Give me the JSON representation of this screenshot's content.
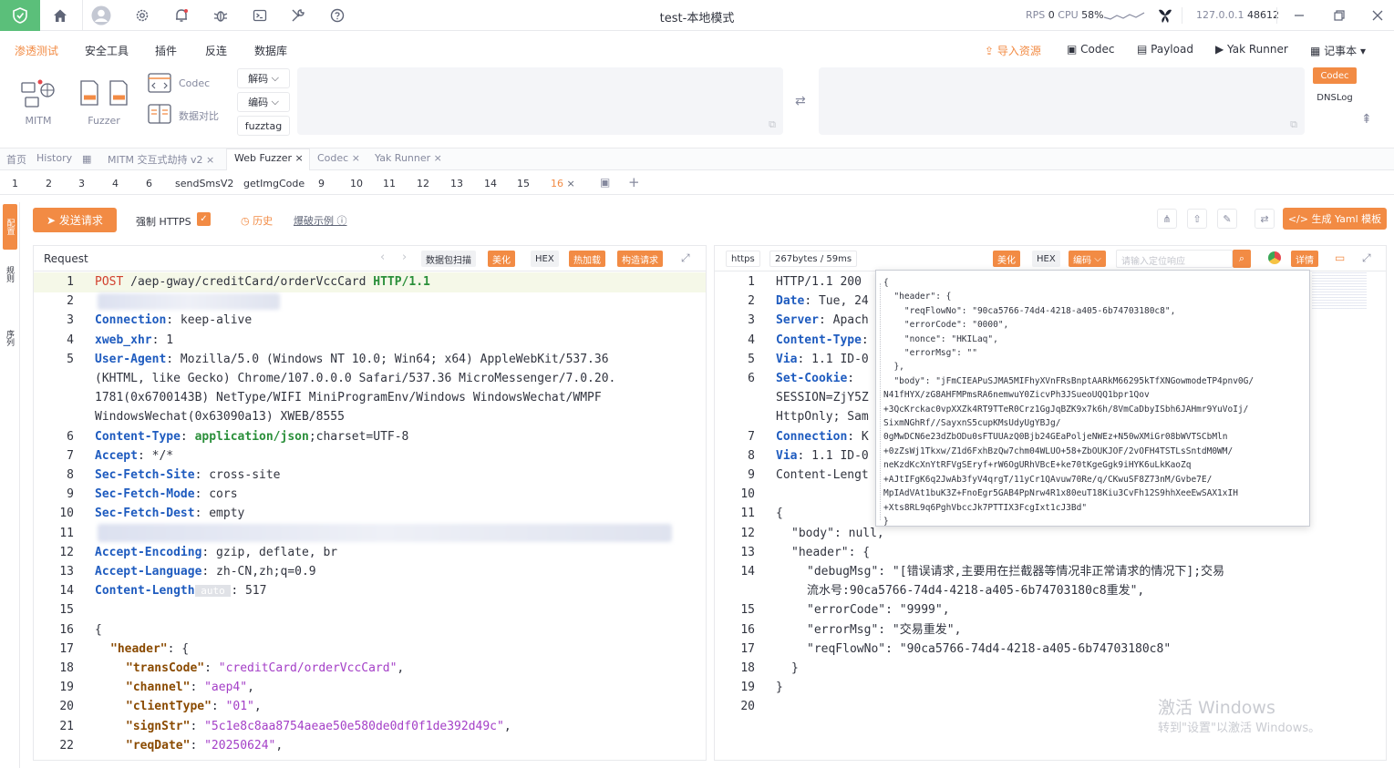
{
  "titlebar": {
    "title": "test-本地模式",
    "rps_label": "RPS",
    "rps_value": "0",
    "cpu_label": "CPU",
    "cpu_value": "58%",
    "host": "127.0.0.1",
    "port": "48612"
  },
  "menu": [
    "渗透测试",
    "安全工具",
    "插件",
    "反连",
    "数据库"
  ],
  "menu_right": [
    "导入资源",
    "Codec",
    "Payload",
    "Yak Runner",
    "记事本"
  ],
  "toolbar": {
    "mitm": "MITM",
    "fuzzer": "Fuzzer",
    "codec": "Codec",
    "data_compare": "数据对比",
    "decode": "解码",
    "encode": "编码",
    "fuzztag": "fuzztag",
    "side_codec": "Codec",
    "side_dnslog": "DNSLog"
  },
  "tabs1": [
    {
      "label": "首页"
    },
    {
      "label": "History"
    },
    {
      "label": "MITM 交互式劫持 v2"
    },
    {
      "label": "Web Fuzzer"
    },
    {
      "label": "Codec"
    },
    {
      "label": "Yak Runner"
    }
  ],
  "tabs2": [
    "1",
    "2",
    "3",
    "4",
    "6",
    "sendSmsV2",
    "getImgCode",
    "9",
    "10",
    "11",
    "12",
    "13",
    "14",
    "15",
    "16"
  ],
  "actions": {
    "send": "发送请求",
    "force_https": "强制 HTTPS",
    "history": "历史",
    "brute_example": "爆破示例",
    "gen_yaml": "生成 Yaml 模板"
  },
  "side_labels": [
    "配置",
    "规则",
    "序列"
  ],
  "request": {
    "title": "Request",
    "tags": [
      "数据包扫描",
      "美化",
      "HEX",
      "热加载",
      "构造请求"
    ],
    "auto_tag": "auto",
    "lines": [
      {
        "n": "1",
        "t": "POST /aep-gway/creditCard/orderVccCard HTTP/1.1"
      },
      {
        "n": "2",
        "t": ""
      },
      {
        "n": "3",
        "t": "Connection: keep-alive"
      },
      {
        "n": "4",
        "t": "xweb_xhr: 1"
      },
      {
        "n": "5",
        "t": "User-Agent: Mozilla/5.0 (Windows NT 10.0; Win64; x64) AppleWebKit/537.36"
      },
      {
        "n": "",
        "t": "(KHTML, like Gecko) Chrome/107.0.0.0 Safari/537.36 MicroMessenger/7.0.20."
      },
      {
        "n": "",
        "t": "1781(0x6700143B) NetType/WIFI MiniProgramEnv/Windows WindowsWechat/WMPF"
      },
      {
        "n": "",
        "t": "WindowsWechat(0x63090a13) XWEB/8555"
      },
      {
        "n": "6",
        "t": "Content-Type: application/json;charset=UTF-8"
      },
      {
        "n": "7",
        "t": "Accept: */*"
      },
      {
        "n": "8",
        "t": "Sec-Fetch-Site: cross-site"
      },
      {
        "n": "9",
        "t": "Sec-Fetch-Mode: cors"
      },
      {
        "n": "10",
        "t": "Sec-Fetch-Dest: empty"
      },
      {
        "n": "11",
        "t": ""
      },
      {
        "n": "12",
        "t": "Accept-Encoding: gzip, deflate, br"
      },
      {
        "n": "13",
        "t": "Accept-Language: zh-CN,zh;q=0.9"
      },
      {
        "n": "14",
        "t": "Content-Length: 517"
      },
      {
        "n": "15",
        "t": ""
      },
      {
        "n": "16",
        "t": "{"
      },
      {
        "n": "17",
        "t": "\"header\": {"
      },
      {
        "n": "18",
        "t": "\"transCode\": \"creditCard/orderVccCard\","
      },
      {
        "n": "19",
        "t": "\"channel\": \"aep4\","
      },
      {
        "n": "20",
        "t": "\"clientType\": \"01\","
      },
      {
        "n": "21",
        "t": "\"signStr\": \"5c1e8c8aa8754aeae50e580de0df0f1de392d49c\","
      },
      {
        "n": "22",
        "t": "\"reqDate\": \"20250624\","
      }
    ]
  },
  "response": {
    "scheme": "https",
    "stats": "267bytes / 59ms",
    "tags": [
      "美化",
      "HEX",
      "编码",
      "详情"
    ],
    "search_placeholder": "请输入定位响应",
    "lines": [
      {
        "n": "1",
        "t": "HTTP/1.1 200"
      },
      {
        "n": "2",
        "t": "Date: Tue, 24"
      },
      {
        "n": "3",
        "t": "Server: Apach"
      },
      {
        "n": "4",
        "t": "Content-Type:"
      },
      {
        "n": "5",
        "t": "Via: 1.1 ID-0"
      },
      {
        "n": "6",
        "t": "Set-Cookie:"
      },
      {
        "n": "",
        "t": "SESSION=ZjY5Z"
      },
      {
        "n": "",
        "t": "HttpOnly; Sam"
      },
      {
        "n": "7",
        "t": "Connection: K"
      },
      {
        "n": "8",
        "t": "Via: 1.1 ID-0"
      },
      {
        "n": "9",
        "t": "Content-Lengt"
      },
      {
        "n": "10",
        "t": ""
      },
      {
        "n": "11",
        "t": "{"
      },
      {
        "n": "12",
        "t": "\"body\": null,"
      },
      {
        "n": "13",
        "t": "\"header\": {"
      },
      {
        "n": "14",
        "t": "\"debugMsg\": \"[错误请求,主要用在拦截器等情况非正常请求的情况下];交易"
      },
      {
        "n": "",
        "t": "流水号:90ca5766-74d4-4218-a405-6b74703180c8重发\","
      },
      {
        "n": "15",
        "t": "\"errorCode\": \"9999\","
      },
      {
        "n": "16",
        "t": "\"errorMsg\": \"交易重发\","
      },
      {
        "n": "17",
        "t": "\"reqFlowNo\": \"90ca5766-74d4-4218-a405-6b74703180c8\""
      },
      {
        "n": "18",
        "t": "}"
      },
      {
        "n": "19",
        "t": "}"
      },
      {
        "n": "20",
        "t": ""
      }
    ]
  },
  "popup": [
    "{",
    "  \"header\": {",
    "    \"reqFlowNo\": \"90ca5766-74d4-4218-a405-6b74703180c8\",",
    "    \"errorCode\": \"0000\",",
    "    \"nonce\": \"HKILaq\",",
    "    \"errorMsg\": \"\"",
    "  },",
    "  \"body\": \"jFmCIEAPuSJMA5MIFhyXVnFRsBnptAARkM66295kTfXNGowmodeTP4pnv0G/",
    "N41fHYX/zG8AHFMPmsRA6nemwuY0ZicvPh3JSueoUQQ1bpr1Qov",
    "+3QcKrckac0vpXXZk4RT9TTeR0Crz1GgJqBZK9x7k6h/8VmCaDbyISbh6JAHmr9YuVoIj/",
    "SixmNGhRf//SayxnS5cupKMsUdyUgYBJg/",
    "0gMwDCN6e23dZbODu0sFTUUAzQ0Bjb24GEaPoljeNWEz+N50wXMiGr08bWVTSCbMln",
    "+0zZsWj1Tkxw/Z1d6FxhBzQw7chm04WLUO+58+ZbOUKJOF/2vOFH4TSTLsSntdM0WM/",
    "neKzdKcXnYtRFVgSEryf+rW6OgURhVBcE+ke70tKgeGgk9iHYK6uLkKaoZq",
    "+AJtIFgK6q2JwAb3fyV4qrgT/11yCr1QAvuw70Re/q/CKwuSF8Z73nM/Gvbe7E/",
    "MpIAdVAt1buK3Z+FnoEgr5GAB4PpNrw4R1x80euT18Kiu3CvFh12S9hhXeeEwSAX1xIH",
    "+Xts8RL9q6PghVbccJk7PTTIX3FcgIxt1cJ3Bd\"",
    "}"
  ],
  "watermark": {
    "line1": "激活 Windows",
    "line2": "转到\"设置\"以激活 Windows。"
  }
}
